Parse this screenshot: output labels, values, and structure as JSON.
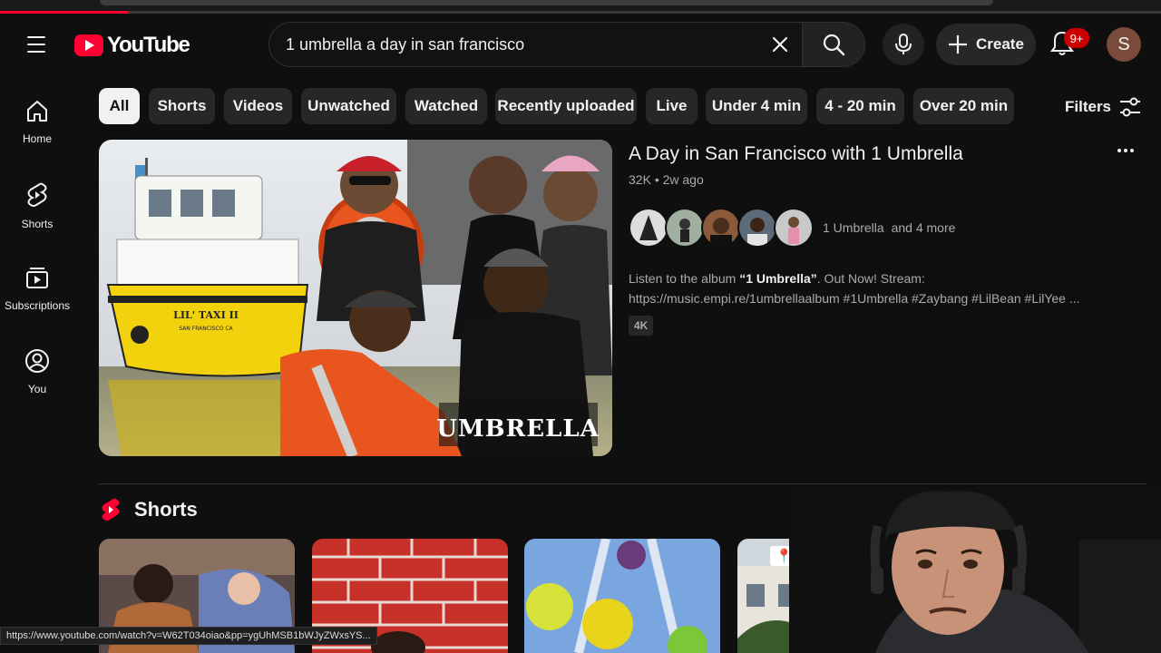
{
  "header": {
    "logo_text": "YouTube",
    "search_value": "1 umbrella a day in san francisco",
    "create_label": "Create",
    "notif_count": "9+",
    "avatar_letter": "S"
  },
  "sidebar": {
    "items": [
      {
        "label": "Home",
        "icon": "home-icon"
      },
      {
        "label": "Shorts",
        "icon": "shorts-icon"
      },
      {
        "label": "Subscriptions",
        "icon": "subscriptions-icon"
      },
      {
        "label": "You",
        "icon": "you-icon"
      }
    ]
  },
  "chips": [
    "All",
    "Shorts",
    "Videos",
    "Unwatched",
    "Watched",
    "Recently uploaded",
    "Live",
    "Under 4 min",
    "4 - 20 min",
    "Over 20 min"
  ],
  "filters_label": "Filters",
  "video": {
    "title": "A Day in San Francisco with 1 Umbrella",
    "views": "32K",
    "age": "2w ago",
    "channel": "1 Umbrella",
    "channel_more": "and 4 more",
    "desc_prefix": "Listen to the album ",
    "desc_bold": "“1 Umbrella”",
    "desc_rest": ". Out Now! Stream: https://music.empi.re/1umbrellaalbum #1Umbrella #Zaybang #LilBean #LilYee ...",
    "badge": "4K",
    "thumb_logo": "UMBRELLA",
    "boat_sign": "LIL' TAXI II",
    "boat_sub": "SAN FRANCISCO CA"
  },
  "shorts": {
    "title": "Shorts",
    "fourth_label": "📍 Lombard Str"
  },
  "status_url": "https://www.youtube.com/watch?v=W62T034oiao&pp=ygUhMSB1bWJyZWxsYS...",
  "colors": {
    "accent": "#ff0033",
    "bg": "#0f0f0f",
    "chip": "#272727"
  },
  "progress": 0.11
}
